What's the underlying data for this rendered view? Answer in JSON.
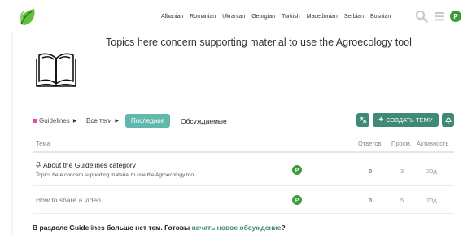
{
  "header": {
    "logo": "leaf-logo",
    "languages": [
      "Albanian",
      "Romanian",
      "Ukranian",
      "Georgian",
      "Turkish",
      "Macedonian",
      "Serbian",
      "Bosnian"
    ],
    "avatar_letter": "P"
  },
  "category": {
    "description": "Topics here concern supporting material to use the Agroecology tool",
    "image": "open-book-icon"
  },
  "nav": {
    "category_crumb": "Guidelines",
    "tags_crumb": "Все теги",
    "tab_latest": "Последние",
    "tab_top": "Обсуждаемые",
    "new_topic": "СОЗДАТЬ ТЕМУ"
  },
  "table": {
    "headers": {
      "topic": "Тема",
      "replies": "Ответов",
      "views": "Просм.",
      "activity": "Активность"
    },
    "rows": [
      {
        "title": "About the Guidelines category",
        "excerpt": "Topics here concern supporting material to use the Agroecology tool",
        "poster": "P",
        "replies": "0",
        "views": "3",
        "activity": "20д",
        "pinned": true
      },
      {
        "title": "How to share a video",
        "poster": "P",
        "replies": "0",
        "views": "5",
        "activity": "20д",
        "pinned": false
      }
    ]
  },
  "footer": {
    "text": "В разделе Guidelines больше нет тем. Готовы ",
    "link": "начать новое обсуждение",
    "end": "?"
  },
  "colors": {
    "brand": "#3d9b35",
    "accent": "#3f8a74",
    "tab_active": "#62b8ad",
    "category": "#e64aa0"
  }
}
